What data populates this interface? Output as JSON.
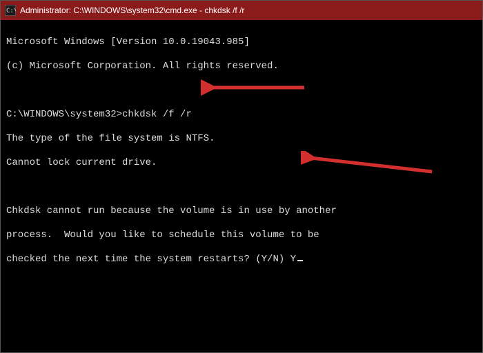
{
  "titlebar": {
    "title": "Administrator: C:\\WINDOWS\\system32\\cmd.exe - chkdsk  /f /r"
  },
  "terminal": {
    "line_version": "Microsoft Windows [Version 10.0.19043.985]",
    "line_copyright": "(c) Microsoft Corporation. All rights reserved.",
    "prompt": "C:\\WINDOWS\\system32>",
    "command": "chkdsk /f /r",
    "line_fs": "The type of the file system is NTFS.",
    "line_lock": "Cannot lock current drive.",
    "line_msg1": "Chkdsk cannot run because the volume is in use by another",
    "line_msg2": "process.  Would you like to schedule this volume to be",
    "line_msg3": "checked the next time the system restarts? (Y/N) ",
    "user_input": "Y"
  },
  "annotations": {
    "arrow1_color": "#d32f2f",
    "arrow2_color": "#d32f2f"
  }
}
